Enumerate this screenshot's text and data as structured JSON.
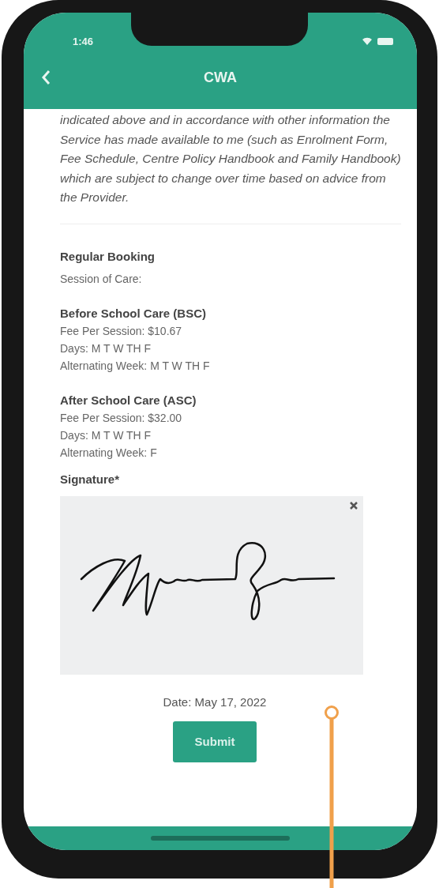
{
  "status_bar": {
    "time": "1:46"
  },
  "header": {
    "title": "CWA"
  },
  "agreement_text": "indicated above and in accordance with other information the Service has made available to me (such as Enrolment Form, Fee Schedule, Centre Policy Handbook and Family Handbook) which are subject to change over time based on advice from the Provider.",
  "booking": {
    "title": "Regular Booking",
    "subtitle": "Session of Care:"
  },
  "sessions": [
    {
      "title": "Before School Care (BSC)",
      "lines": [
        "Fee Per Session: $10.67",
        "Days: M T W TH F",
        "Alternating Week: M T W TH F"
      ]
    },
    {
      "title": "After School Care (ASC)",
      "lines": [
        "Fee Per Session: $32.00",
        "Days: M T W TH F",
        "Alternating Week: F"
      ]
    }
  ],
  "signature": {
    "label": "Signature*"
  },
  "date": "Date: May 17, 2022",
  "submit": "Submit"
}
